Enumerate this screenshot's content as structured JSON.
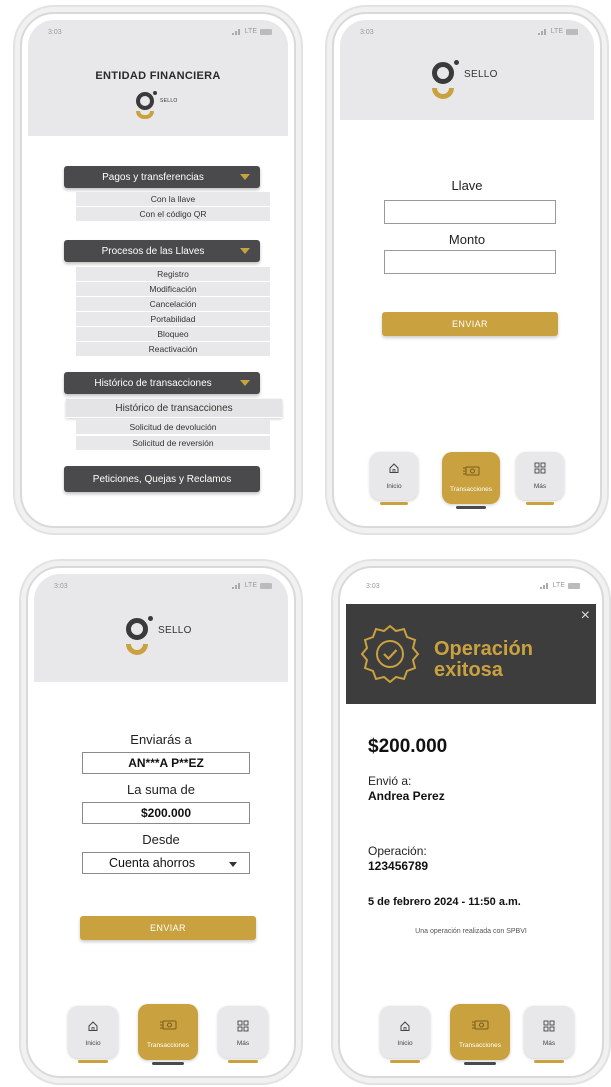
{
  "status": {
    "time": "3:03",
    "network": "LTE"
  },
  "brand": {
    "logo_text": "SELLO"
  },
  "screen1": {
    "title": "ENTIDAD FINANCIERA",
    "menus": [
      {
        "label": "Pagos y transferencias",
        "items": [
          "Con la llave",
          "Con el código QR"
        ]
      },
      {
        "label": "Procesos de las Llaves",
        "items": [
          "Registro",
          "Modificación",
          "Cancelación",
          "Portabilidad",
          "Bloqueo",
          "Reactivación"
        ]
      },
      {
        "label": "Histórico de transacciones",
        "items": [
          "Histórico de transacciones",
          "Solicitud de devolución",
          "Solicitud de reversión"
        ]
      },
      {
        "label": "Peticiones, Quejas y Reclamos",
        "items": []
      }
    ]
  },
  "screen2": {
    "llave_label": "Llave",
    "monto_label": "Monto",
    "send_label": "ENVIAR"
  },
  "screen3": {
    "to_label": "Enviarás a",
    "to_value": "AN***A P**EZ",
    "amount_label": "La suma de",
    "amount_value": "$200.000",
    "from_label": "Desde",
    "from_value": "Cuenta ahorros",
    "send_label": "ENVIAR"
  },
  "screen4": {
    "banner_line1": "Operación",
    "banner_line2": "exitosa",
    "amount": "$200.000",
    "sent_to_label": "Envió a:",
    "sent_to_value": "Andrea Perez",
    "operation_label": "Operación:",
    "operation_value": "123456789",
    "datetime": "5 de febrero 2024 - 11:50 a.m.",
    "footnote": "Una operación realizada con SPBVI"
  },
  "nav": {
    "home": "Inicio",
    "transactions": "Transacciones",
    "more": "Más"
  },
  "colors": {
    "gold": "#c9a23f",
    "dark": "#4a4a4c",
    "banner": "#3d3d3d",
    "header_gray": "#e8e8ea"
  }
}
